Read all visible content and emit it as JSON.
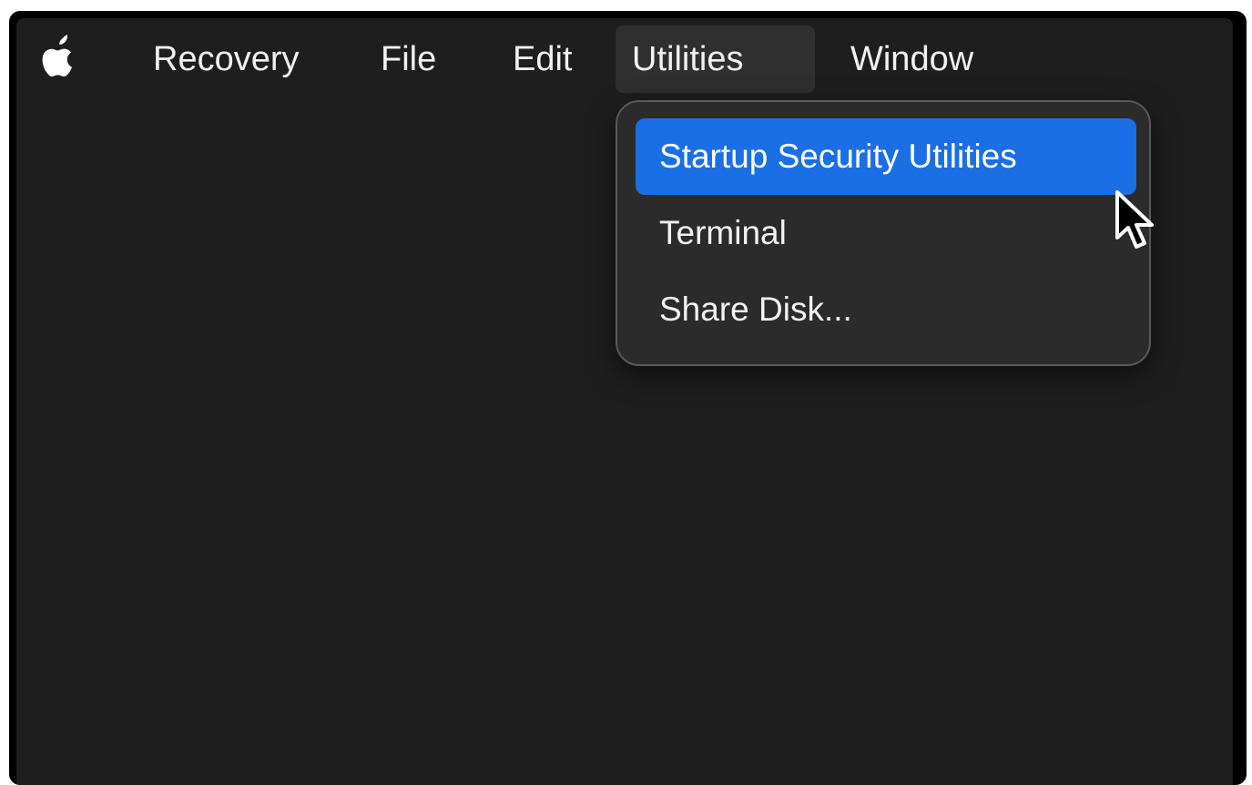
{
  "menubar": {
    "apple_icon": "apple-logo-icon",
    "items": [
      {
        "label": "Recovery"
      },
      {
        "label": "File"
      },
      {
        "label": "Edit"
      },
      {
        "label": "Utilities"
      },
      {
        "label": "Window"
      }
    ],
    "active_item": "Utilities"
  },
  "utilities_menu": {
    "items": [
      {
        "label": "Startup Security Utilities",
        "selected": true
      },
      {
        "label": "Terminal",
        "selected": false
      },
      {
        "label": "Share Disk...",
        "selected": false
      }
    ]
  },
  "cursor": {
    "icon": "mouse-pointer-icon"
  },
  "colors": {
    "background": "#1e1e1e",
    "menu_bg": "#2b2b2b",
    "highlight": "#1b6fe6",
    "text": "#f2f2f2"
  }
}
